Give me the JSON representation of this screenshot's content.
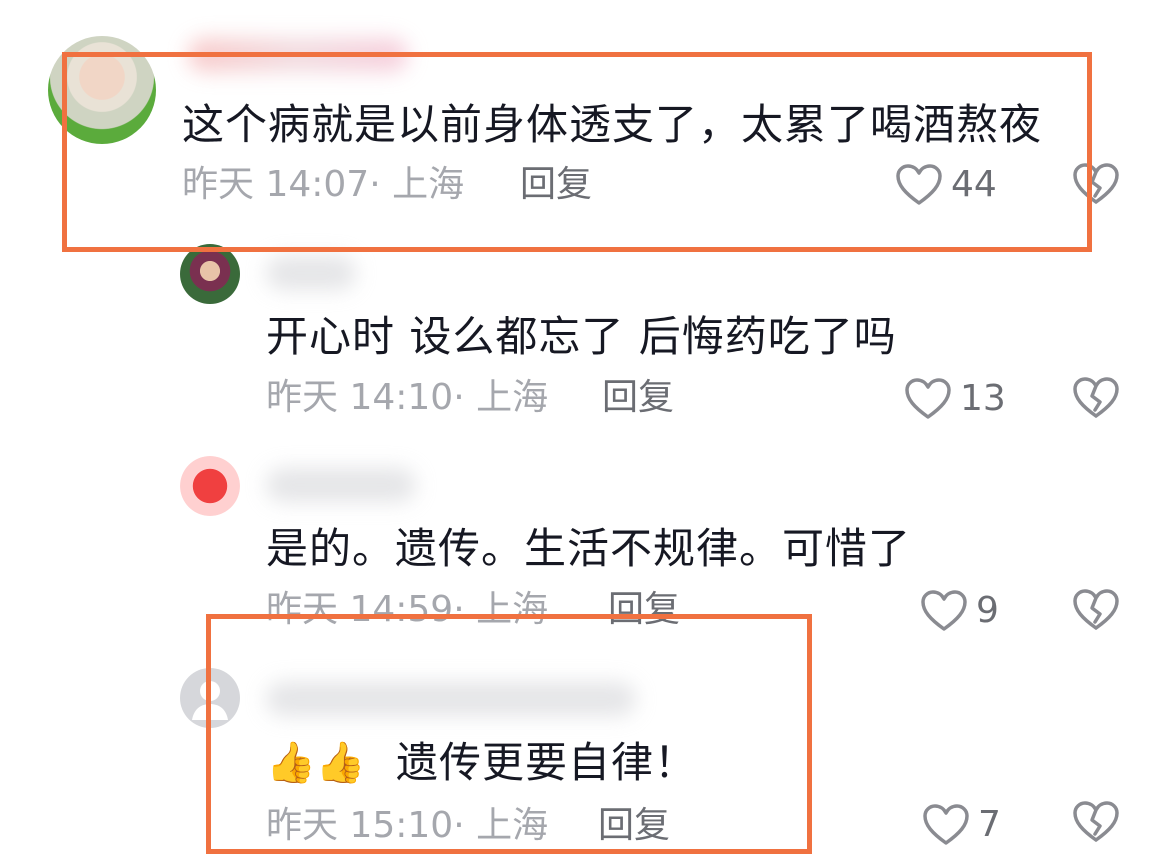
{
  "comments": [
    {
      "text": "这个病就是以前身体透支了，太累了喝酒熬夜",
      "time": "昨天 14:07· 上海",
      "reply": "回复",
      "likes": "44"
    },
    {
      "text": "开心时 设么都忘了 后悔药吃了吗",
      "time": "昨天 14:10· 上海",
      "reply": "回复",
      "likes": "13"
    },
    {
      "text": "是的。遗传。生活不规律。可惜了",
      "time": "昨天 14:59· 上海",
      "reply": "回复",
      "likes": "9"
    },
    {
      "emoji": "👍👍",
      "text": "遗传更要自律！",
      "time": "昨天 15:10· 上海",
      "reply": "回复",
      "likes": "7"
    }
  ],
  "icons": {
    "like": "heart-outline-icon",
    "dislike": "broken-heart-icon"
  },
  "colors": {
    "highlight": "#f07140",
    "meta": "#a5a7ad",
    "text": "#161823"
  }
}
